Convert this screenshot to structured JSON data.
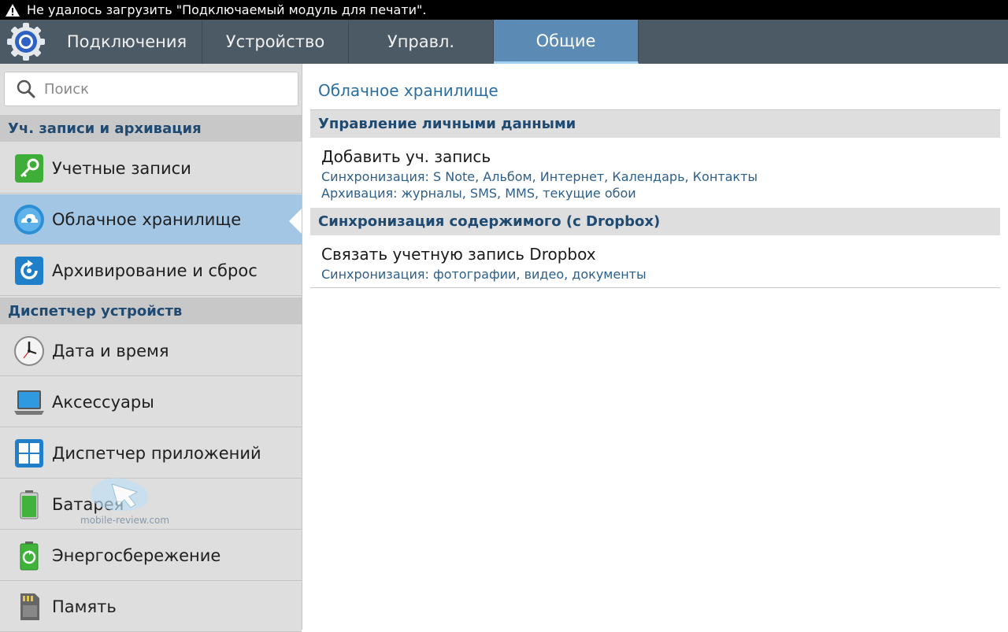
{
  "status_bar": {
    "message": "Не удалось загрузить \"Подключаемый модуль для печати\".",
    "icon": "warning-icon"
  },
  "tabs": [
    {
      "label": "Подключения",
      "active": false
    },
    {
      "label": "Устройство",
      "active": false
    },
    {
      "label": "Управл.",
      "active": false
    },
    {
      "label": "Общие",
      "active": true
    }
  ],
  "search": {
    "placeholder": "Поиск",
    "value": ""
  },
  "sidebar": {
    "sections": [
      {
        "title": "Уч. записи и архивация",
        "items": [
          {
            "label": "Учетные записи",
            "icon": "key-icon"
          },
          {
            "label": "Облачное хранилище",
            "icon": "cloud-icon",
            "selected": true
          },
          {
            "label": "Архивирование и сброс",
            "icon": "backup-reset-icon"
          }
        ]
      },
      {
        "title": "Диспетчер устройств",
        "items": [
          {
            "label": "Дата и время",
            "icon": "clock-icon"
          },
          {
            "label": "Аксессуары",
            "icon": "laptop-icon"
          },
          {
            "label": "Диспетчер приложений",
            "icon": "app-grid-icon"
          },
          {
            "label": "Батарея",
            "icon": "battery-icon"
          },
          {
            "label": "Энергосбережение",
            "icon": "power-saving-icon"
          },
          {
            "label": "Память",
            "icon": "sd-card-icon"
          }
        ]
      }
    ]
  },
  "content": {
    "title": "Облачное хранилище",
    "sections": [
      {
        "header": "Управление личными данными",
        "items": [
          {
            "title": "Добавить уч. запись",
            "lines": [
              "Синхронизация: S Note, Альбом, Интернет, Календарь, Контакты",
              "Архивация: журналы, SMS, MMS, текущие обои"
            ]
          }
        ]
      },
      {
        "header": "Синхронизация содержимого (с Dropbox)",
        "items": [
          {
            "title": "Связать учетную запись Dropbox",
            "lines": [
              "Синхронизация: фотографии, видео, документы"
            ]
          }
        ]
      }
    ]
  },
  "watermark": {
    "text": "mobile-review.com"
  },
  "colors": {
    "tab_bar": "#4b5a64",
    "tab_active": "#5b8bb4",
    "selected_item": "#a4c6e5",
    "section_text": "#1f4a72",
    "accent_text": "#2a6fa3"
  }
}
